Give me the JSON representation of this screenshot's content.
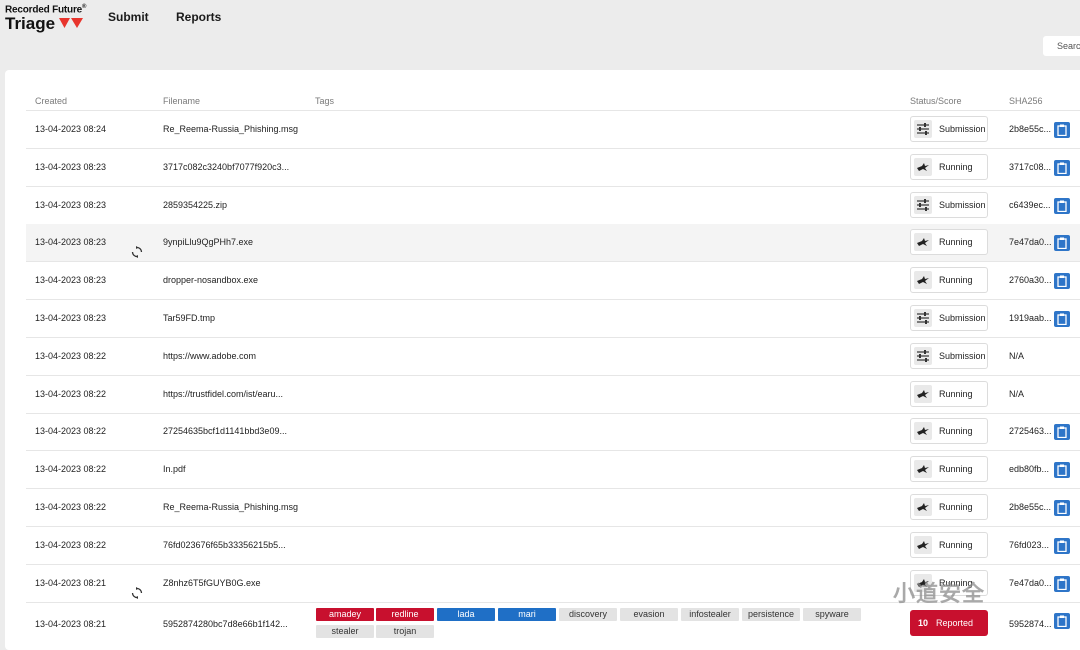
{
  "brand": {
    "small": "Recorded Future",
    "reg": "®",
    "main": "Triage"
  },
  "nav": {
    "submit": "Submit",
    "reports": "Reports"
  },
  "search": {
    "placeholder": "Search"
  },
  "columns": {
    "created": "Created",
    "filename": "Filename",
    "tags": "Tags",
    "status": "Status/Score",
    "sha": "SHA256"
  },
  "rows": [
    {
      "created": "13-04-2023 08:24",
      "filename": "Re_Reema-Russia_Phishing.msg",
      "status": "Submission",
      "sha": "2b8e55c...",
      "refresh": false,
      "copy": true
    },
    {
      "created": "13-04-2023 08:23",
      "filename": "3717c082c3240bf7077f920c3...",
      "status": "Running",
      "sha": "3717c08...",
      "refresh": false,
      "copy": true
    },
    {
      "created": "13-04-2023 08:23",
      "filename": "2859354225.zip",
      "status": "Submission",
      "sha": "c6439ec...",
      "refresh": false,
      "copy": true
    },
    {
      "created": "13-04-2023 08:23",
      "filename": "9ynpiLlu9QgPHh7.exe",
      "status": "Running",
      "sha": "7e47da0...",
      "refresh": true,
      "copy": true
    },
    {
      "created": "13-04-2023 08:23",
      "filename": "dropper-nosandbox.exe",
      "status": "Running",
      "sha": "2760a30...",
      "refresh": false,
      "copy": true
    },
    {
      "created": "13-04-2023 08:23",
      "filename": "Tar59FD.tmp",
      "status": "Submission",
      "sha": "1919aab...",
      "refresh": false,
      "copy": true
    },
    {
      "created": "13-04-2023 08:22",
      "filename": "https://www.adobe.com",
      "status": "Submission",
      "sha": "N/A",
      "refresh": false,
      "copy": false
    },
    {
      "created": "13-04-2023 08:22",
      "filename": "https://trustfidel.com/ist/earu...",
      "status": "Running",
      "sha": "N/A",
      "refresh": false,
      "copy": false
    },
    {
      "created": "13-04-2023 08:22",
      "filename": "27254635bcf1d1141bbd3e09...",
      "status": "Running",
      "sha": "2725463...",
      "refresh": false,
      "copy": true
    },
    {
      "created": "13-04-2023 08:22",
      "filename": "In.pdf",
      "status": "Running",
      "sha": "edb80fb...",
      "refresh": false,
      "copy": true
    },
    {
      "created": "13-04-2023 08:22",
      "filename": "Re_Reema-Russia_Phishing.msg",
      "status": "Running",
      "sha": "2b8e55c...",
      "refresh": false,
      "copy": true
    },
    {
      "created": "13-04-2023 08:22",
      "filename": "76fd023676f65b33356215b5...",
      "status": "Running",
      "sha": "76fd023...",
      "refresh": false,
      "copy": true
    },
    {
      "created": "13-04-2023 08:21",
      "filename": "Z8nhz6T5fGUYB0G.exe",
      "status": "Running",
      "sha": "7e47da0...",
      "refresh": true,
      "copy": true
    }
  ],
  "last_row": {
    "created": "13-04-2023 08:21",
    "filename": "5952874280bc7d8e66b1f142...",
    "tags": [
      {
        "label": "amadey",
        "kind": "red"
      },
      {
        "label": "redline",
        "kind": "red"
      },
      {
        "label": "lada",
        "kind": "blue"
      },
      {
        "label": "mari",
        "kind": "blue"
      },
      {
        "label": "discovery",
        "kind": "gray"
      },
      {
        "label": "evasion",
        "kind": "gray"
      },
      {
        "label": "infostealer",
        "kind": "gray"
      },
      {
        "label": "persistence",
        "kind": "gray"
      },
      {
        "label": "spyware",
        "kind": "gray"
      },
      {
        "label": "stealer",
        "kind": "gray"
      },
      {
        "label": "trojan",
        "kind": "gray"
      }
    ],
    "score": "10",
    "status": "Reported",
    "sha": "5952874..."
  },
  "watermark": "小道安全",
  "colors": {
    "accent_blue": "#2e75c8",
    "reported_red": "#c8102e",
    "tag_blue": "#1f6fc6",
    "tag_gray": "#e3e3e3"
  },
  "icons": {
    "submission": "sliders-icon",
    "running": "bird-icon",
    "copy": "clipboard-icon",
    "refresh": "refresh-icon"
  }
}
